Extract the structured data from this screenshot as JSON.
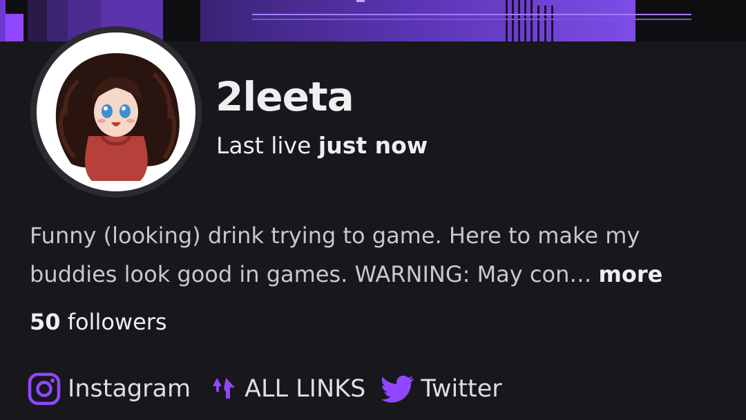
{
  "channel": {
    "name": "2leeta",
    "last_live_prefix": "Last live",
    "last_live_value": "just now",
    "avatar_icon": "avatar-character-icon"
  },
  "bio": {
    "text": "Funny (looking) drink trying to game. Here to make my buddies look good in games. WARNING: May con…",
    "more_label": "more"
  },
  "followers": {
    "count": "50",
    "label": "followers"
  },
  "social_links": [
    {
      "label": "Instagram",
      "icon": "instagram-icon"
    },
    {
      "label": "ALL LINKS",
      "icon": "linktree-icon"
    },
    {
      "label": "Twitter",
      "icon": "twitter-icon"
    }
  ],
  "colors": {
    "background": "#18171c",
    "accent": "#9147ff",
    "text": "#efeff1",
    "muted_text": "#c8c8cf"
  }
}
